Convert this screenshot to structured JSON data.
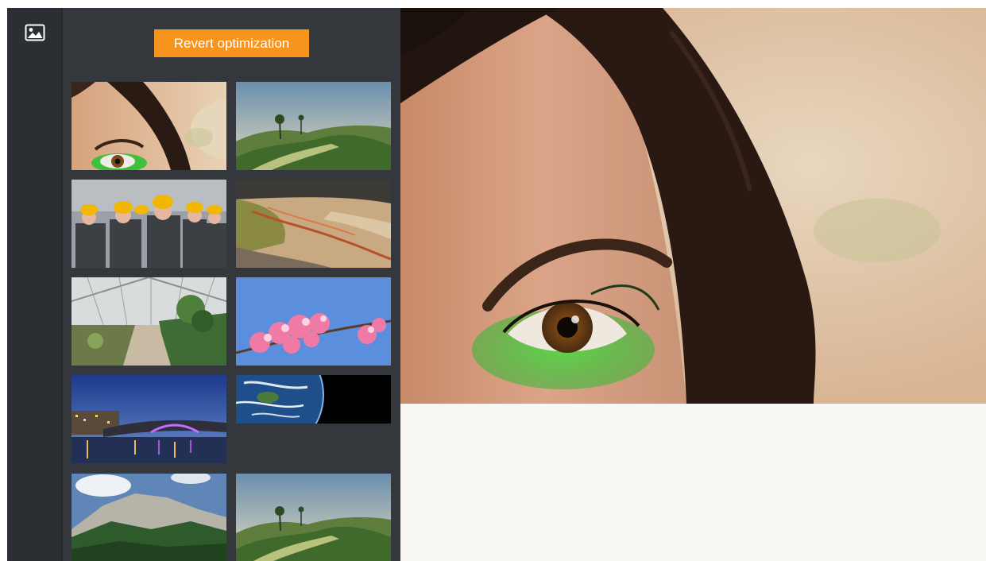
{
  "toolbar": {
    "gallery_icon": "image-icon"
  },
  "panel": {
    "revert_label": "Revert optimization",
    "accent_color": "#f7941d",
    "thumbnails": [
      {
        "subject": "woman-eye"
      },
      {
        "subject": "tropical-hills"
      },
      {
        "subject": "workers-hardhats"
      },
      {
        "subject": "canyon-river"
      },
      {
        "subject": "greenhouse"
      },
      {
        "subject": "cherry-blossom"
      },
      {
        "subject": "night-bridge"
      },
      {
        "subject": "earth-space"
      },
      {
        "subject": "mountain-forest"
      },
      {
        "subject": "tropical-hills"
      }
    ]
  },
  "viewer": {
    "image_subject": "woman-eye"
  }
}
